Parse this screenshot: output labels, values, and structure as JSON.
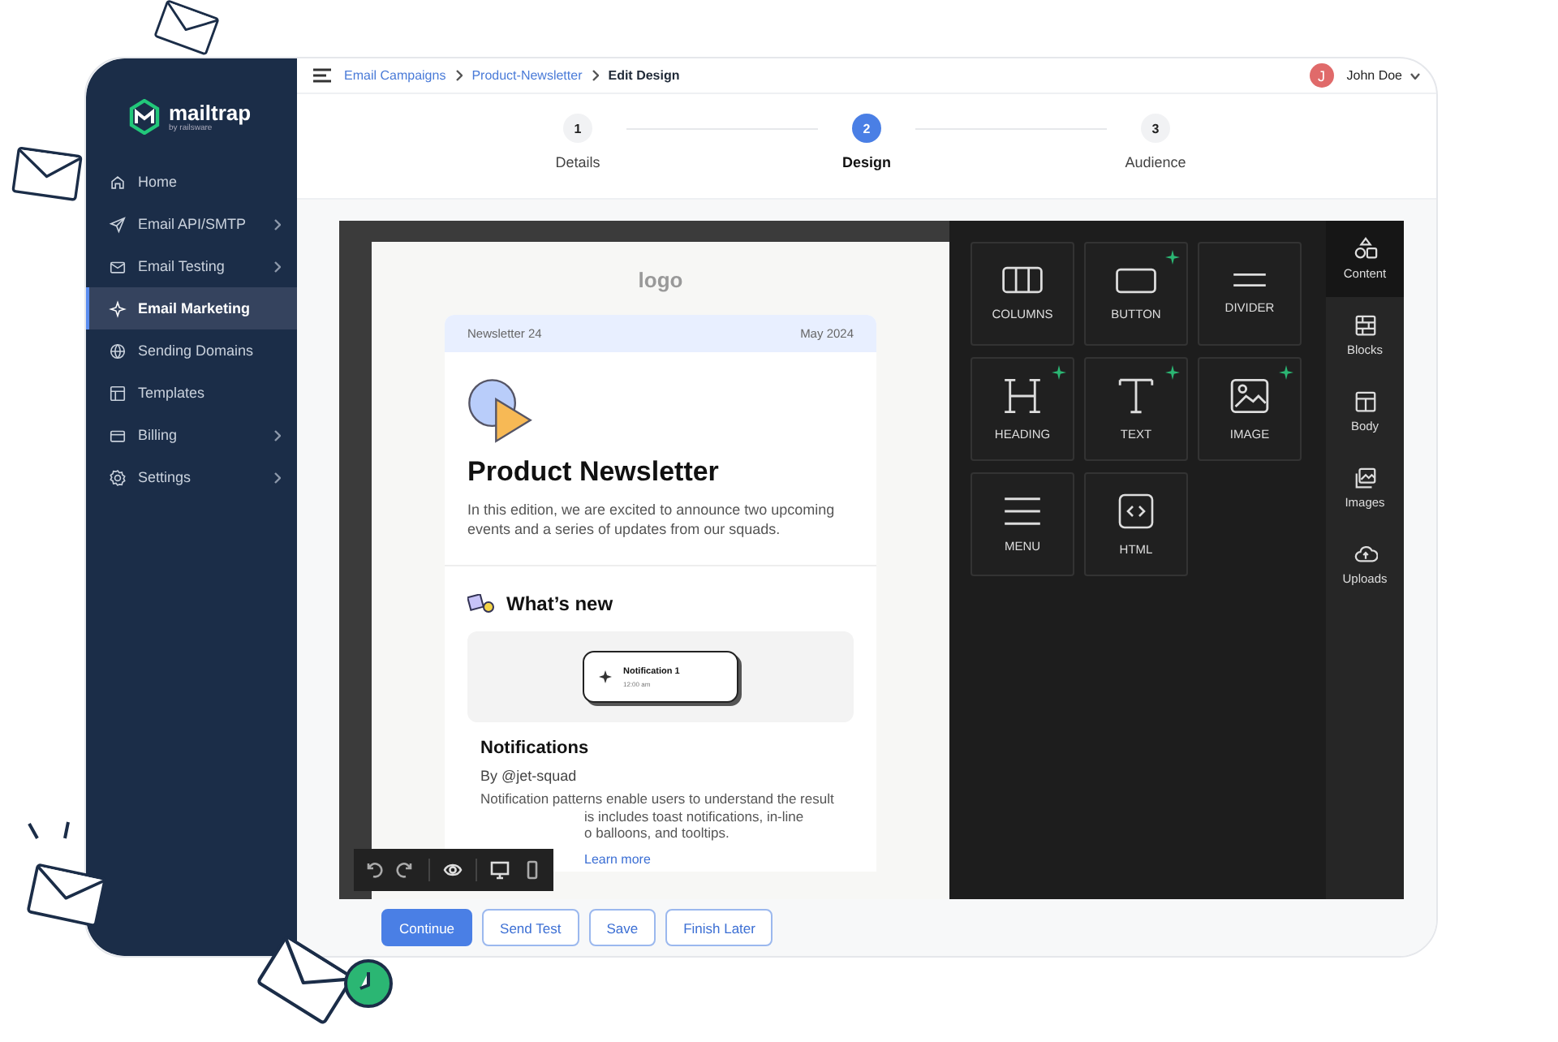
{
  "sidebar": {
    "logo": {
      "name": "mailtrap",
      "tagline": "by railsware"
    },
    "items": [
      {
        "label": "Home",
        "has_submenu": false,
        "selected": false
      },
      {
        "label": "Email API/SMTP",
        "has_submenu": true,
        "selected": false
      },
      {
        "label": "Email Testing",
        "has_submenu": true,
        "selected": false
      },
      {
        "label": "Email Marketing",
        "has_submenu": false,
        "selected": true
      },
      {
        "label": "Sending Domains",
        "has_submenu": false,
        "selected": false
      },
      {
        "label": "Templates",
        "has_submenu": false,
        "selected": false
      },
      {
        "label": "Billing",
        "has_submenu": true,
        "selected": false
      },
      {
        "label": "Settings",
        "has_submenu": true,
        "selected": false
      }
    ]
  },
  "breadcrumbs": [
    {
      "label": "Email Campaigns",
      "current": false
    },
    {
      "label": "Product-Newsletter",
      "current": false
    },
    {
      "label": "Edit Design",
      "current": true
    }
  ],
  "user": {
    "initial": "J",
    "name": "John Doe"
  },
  "steps": [
    {
      "number": "1",
      "label": "Details",
      "selected": false
    },
    {
      "number": "2",
      "label": "Design",
      "selected": true
    },
    {
      "number": "3",
      "label": "Audience",
      "selected": false
    }
  ],
  "email": {
    "logo": "logo",
    "issue": "Newsletter 24",
    "date": "May 2024",
    "title": "Product Newsletter",
    "intro": "In this edition, we are excited to announce two upcoming events and a series of updates from our squads.",
    "section_title": "What’s new",
    "notification": {
      "title": "Notification 1",
      "time": "12:00 am"
    },
    "article_title": "Notifications",
    "byline": "By @jet-squad",
    "body_lines": [
      {
        "text": "Notification patterns enable users to understand the result",
        "covered": false
      },
      {
        "text": "is includes toast notifications, in-line",
        "covered": true
      },
      {
        "text": "o balloons, and tooltips.",
        "covered": true
      }
    ],
    "link": "Learn more"
  },
  "content_tiles": [
    {
      "label": "COLUMNS",
      "sparkle": false
    },
    {
      "label": "BUTTON",
      "sparkle": true
    },
    {
      "label": "DIVIDER",
      "sparkle": false
    },
    {
      "label": "HEADING",
      "sparkle": true
    },
    {
      "label": "TEXT",
      "sparkle": true
    },
    {
      "label": "IMAGE",
      "sparkle": true
    },
    {
      "label": "MENU",
      "sparkle": false
    },
    {
      "label": "HTML",
      "sparkle": false
    }
  ],
  "side_tabs": [
    {
      "label": "Content",
      "selected": true
    },
    {
      "label": "Blocks",
      "selected": false
    },
    {
      "label": "Body",
      "selected": false
    },
    {
      "label": "Images",
      "selected": false
    },
    {
      "label": "Uploads",
      "selected": false
    }
  ],
  "buttons": [
    {
      "label": "Continue",
      "kind": "primary"
    },
    {
      "label": "Send Test",
      "kind": "outline"
    },
    {
      "label": "Save",
      "kind": "outline"
    },
    {
      "label": "Finish Later",
      "kind": "outline"
    }
  ]
}
